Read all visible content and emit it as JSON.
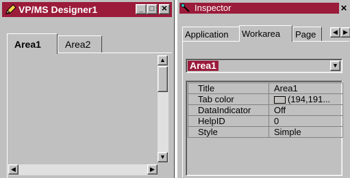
{
  "designer": {
    "title": "VP/MS Designer1",
    "window_buttons": {
      "minimize": "_",
      "maximize": "□",
      "close": "✕"
    },
    "tabs": [
      {
        "label": "Area1",
        "active": true
      },
      {
        "label": "Area2",
        "active": false
      }
    ]
  },
  "inspector": {
    "title": "Inspector",
    "close": "✕",
    "tabs": [
      {
        "label": "Application",
        "active": false
      },
      {
        "label": "Workarea",
        "active": true
      },
      {
        "label": "Page",
        "active": false
      }
    ],
    "selected_object": "Area1",
    "properties": [
      {
        "name": "Title",
        "value": "Area1"
      },
      {
        "name": "Tab color",
        "value": "(194,191..."
      },
      {
        "name": "DataIndicator",
        "value": "Off"
      },
      {
        "name": "HelpID",
        "value": "0"
      },
      {
        "name": "Style",
        "value": "Simple"
      }
    ]
  },
  "colors": {
    "titlebar": "#9b1b3a",
    "face": "#c0c0c0",
    "tab_swatch": "#c2bfbf"
  },
  "icons": [
    "pencil-icon",
    "wand-icon",
    "scroll-up-icon",
    "scroll-down-icon",
    "scroll-left-icon",
    "scroll-right-icon",
    "dropdown-arrow-icon"
  ]
}
